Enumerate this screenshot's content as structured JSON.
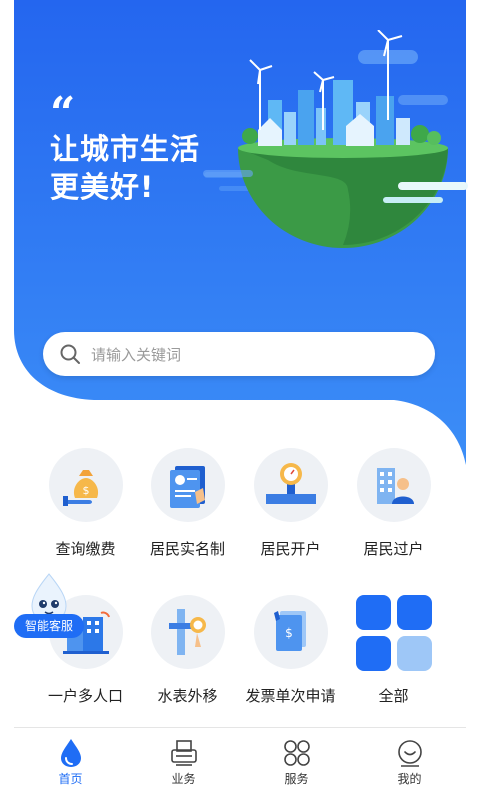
{
  "banner": {
    "quote_mark": "“",
    "slogan_line1": "让城市生活",
    "slogan_line2": "更美好!"
  },
  "search": {
    "placeholder": "请输入关键词"
  },
  "services": [
    {
      "label": "查询缴费",
      "icon": "money-bag-icon"
    },
    {
      "label": "居民实名制",
      "icon": "id-card-icon"
    },
    {
      "label": "居民开户",
      "icon": "water-meter-icon"
    },
    {
      "label": "居民过户",
      "icon": "person-building-icon"
    },
    {
      "label": "一户多人口",
      "icon": "household-building-icon"
    },
    {
      "label": "水表外移",
      "icon": "meter-relocate-icon"
    },
    {
      "label": "发票单次申请",
      "icon": "invoice-icon"
    },
    {
      "label": "全部",
      "icon": "all-grid-icon"
    }
  ],
  "customer_service": {
    "label": "智能客服"
  },
  "tabbar": [
    {
      "label": "首页",
      "icon": "home-drop-icon",
      "active": true
    },
    {
      "label": "业务",
      "icon": "business-printer-icon",
      "active": false
    },
    {
      "label": "服务",
      "icon": "service-grid-icon",
      "active": false
    },
    {
      "label": "我的",
      "icon": "profile-icon",
      "active": false
    }
  ],
  "colors": {
    "primary": "#1f6df5",
    "banner_top": "#2a6ff0",
    "banner_bottom": "#3b8cf7"
  }
}
